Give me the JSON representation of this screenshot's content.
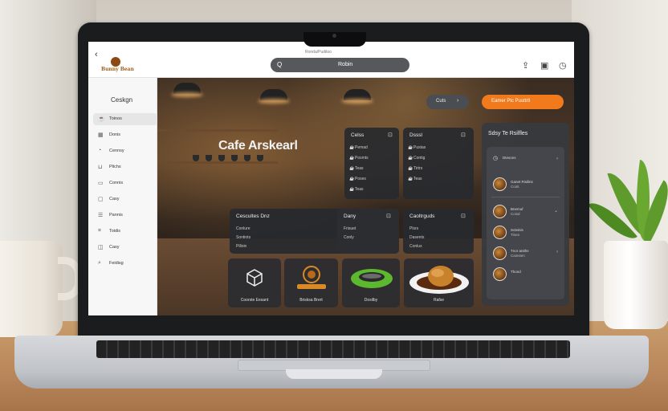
{
  "browser": {
    "back": "‹",
    "logo_text": "Bunny Bean",
    "url_hint": "Ronda/Puditoo",
    "search_icon": "search-icon",
    "search_glyph": "Q",
    "search_value": "Robin",
    "toolbar_icons": [
      "share-icon",
      "tabs-icon",
      "history-icon"
    ]
  },
  "sidebar": {
    "title": "Ceskgn",
    "items": [
      {
        "label": "Toinos",
        "icon": "coffee-icon",
        "active": true
      },
      {
        "label": "Donis",
        "icon": "grid-icon",
        "active": false
      },
      {
        "label": "Cennsy",
        "icon": "clock-icon",
        "active": false
      },
      {
        "label": "Plichs",
        "icon": "cup-icon",
        "active": false
      },
      {
        "label": "Connis",
        "icon": "card-icon",
        "active": false
      },
      {
        "label": "Casy",
        "icon": "box-icon",
        "active": false
      },
      {
        "label": "Pannis",
        "icon": "list-icon",
        "active": false
      },
      {
        "label": "Toidis",
        "icon": "tag-icon",
        "active": false
      },
      {
        "label": "Casy",
        "icon": "bag-icon",
        "active": false
      },
      {
        "label": "Feidisg",
        "icon": "search-icon",
        "active": false
      }
    ]
  },
  "hero": {
    "title": "Cafe Arskearl"
  },
  "actions": {
    "dark_pill": "Cuts",
    "dark_pill_arrow": "›",
    "orange_pill": "Eamer Ptc Pusttrll"
  },
  "cards": {
    "card1": {
      "title": "Celss",
      "rows": [
        "Pemad",
        "Posmts",
        "Teas",
        "Poses",
        "Teas"
      ]
    },
    "card2": {
      "title": "Dsssl",
      "rows": [
        "Pustas",
        "Contig",
        "Tirtrs",
        "Teas"
      ]
    },
    "card3": {
      "title": "Cescultes Dnz",
      "rows": [
        "Conlure",
        "Sontiots",
        "Pilloin"
      ]
    },
    "card4": {
      "title": "Dany",
      "rows": [
        "Frisuet",
        "Conly"
      ]
    },
    "card5": {
      "title": "Caoltrguds",
      "rows": [
        "Plsrs",
        "Dasents",
        "Conlus"
      ]
    }
  },
  "tiles": [
    {
      "label": "Coorste Eesant",
      "icon": "box-cube-icon"
    },
    {
      "label": "Brisksa Brert",
      "icon": "brand-logo-icon"
    },
    {
      "label": "Dosilby",
      "icon": "plate-dish-icon"
    },
    {
      "label": "Rafse",
      "icon": "plate-food-icon"
    }
  ],
  "right_panel": {
    "title": "Sdsy Te Rsilfles",
    "header_row": {
      "label": "Dtesons",
      "chev": "›"
    },
    "items": [
      {
        "name": "Ganet Risilins",
        "sub": "Coirit",
        "chev": ""
      },
      {
        "name": "Bnemuf",
        "sub": "Coisd",
        "chev": "⌄"
      },
      {
        "name": "Sotvinis",
        "sub": "Tinen",
        "chev": ""
      },
      {
        "name": "Tnor aniths",
        "sub": "Cainsten",
        "chev": "›"
      },
      {
        "name": "Thond",
        "sub": "",
        "chev": ""
      }
    ]
  }
}
